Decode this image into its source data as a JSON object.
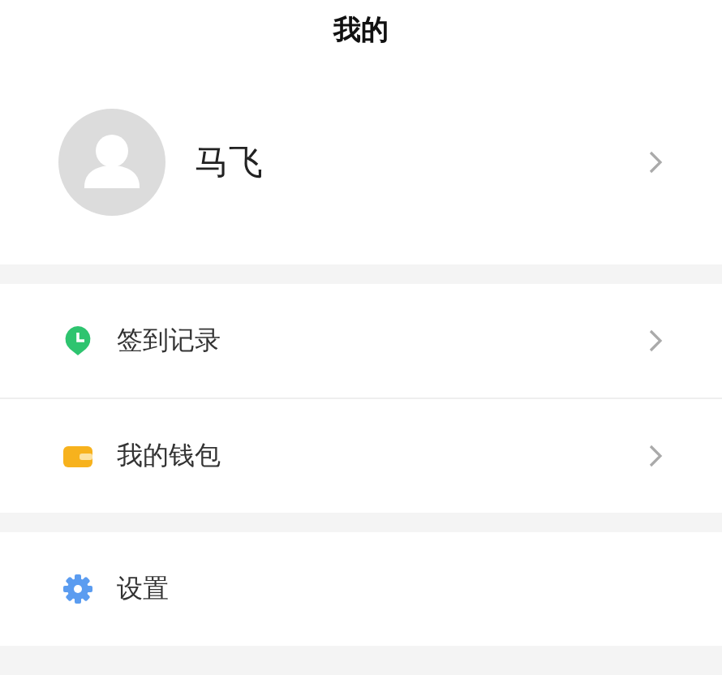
{
  "header": {
    "title": "我的"
  },
  "profile": {
    "name": "马飞",
    "chevron": true
  },
  "sections": [
    {
      "items": [
        {
          "label": "签到记录",
          "kind": "pin",
          "chevron": true
        },
        {
          "label": "我的钱包",
          "kind": "wallet",
          "chevron": true
        }
      ]
    },
    {
      "items": [
        {
          "label": "设置",
          "kind": "gear",
          "chevron": false
        }
      ]
    }
  ]
}
